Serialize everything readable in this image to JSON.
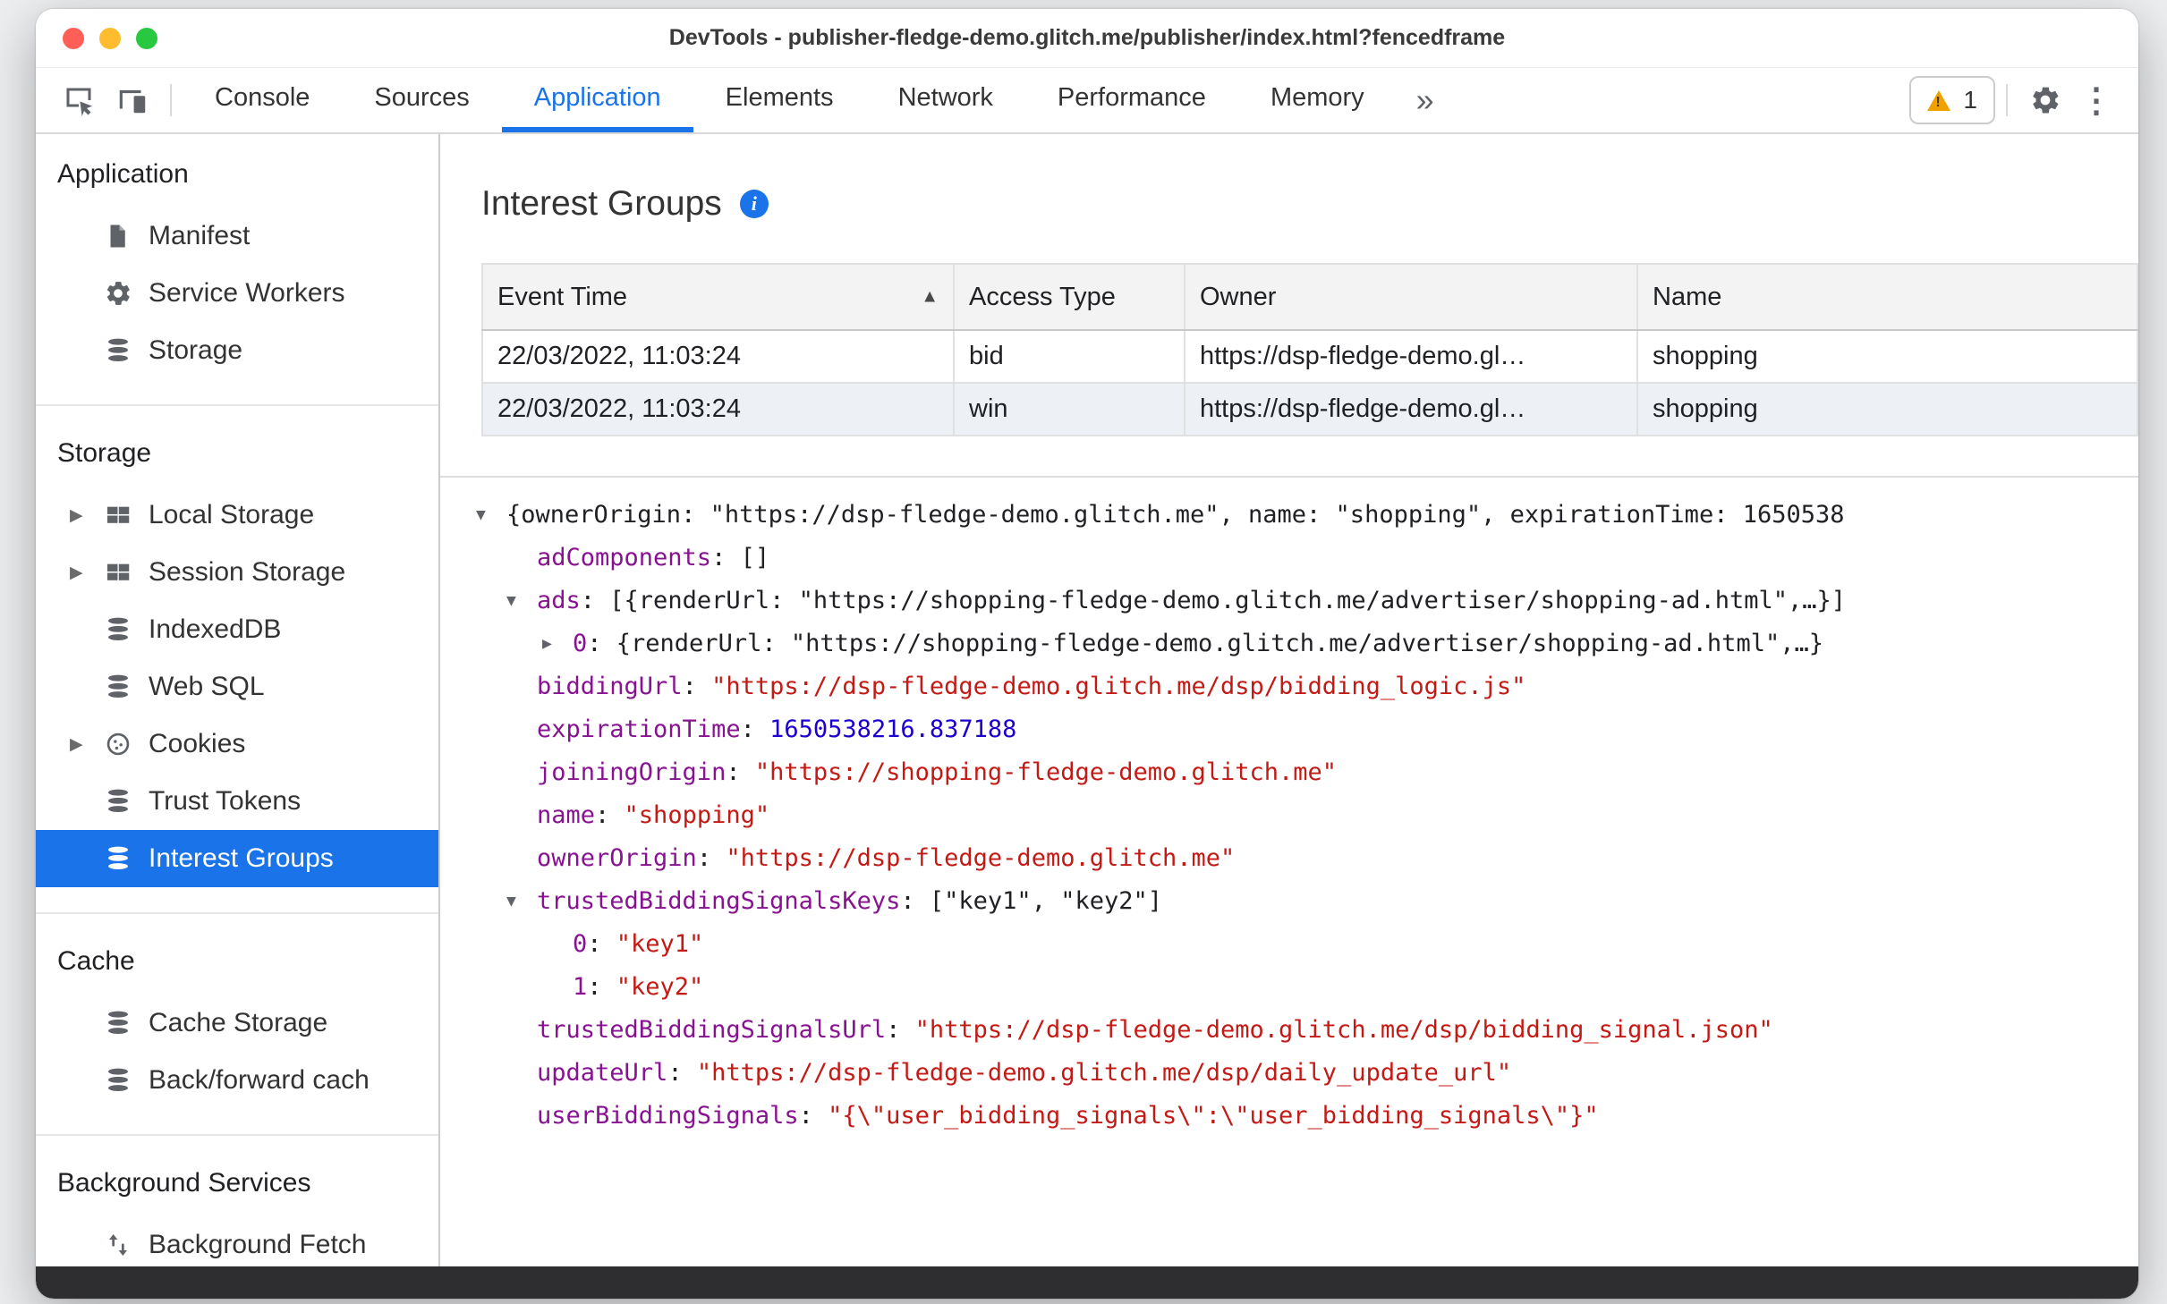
{
  "window": {
    "title": "DevTools - publisher-fledge-demo.glitch.me/publisher/index.html?fencedframe"
  },
  "toolbar": {
    "tabs": [
      "Console",
      "Sources",
      "Application",
      "Elements",
      "Network",
      "Performance",
      "Memory"
    ],
    "active_tab": "Application",
    "more_tabs_label": "»",
    "warning_count": "1"
  },
  "sidebar": {
    "sections": [
      {
        "header": "Application",
        "items": [
          {
            "label": "Manifest",
            "icon": "file"
          },
          {
            "label": "Service Workers",
            "icon": "gear"
          },
          {
            "label": "Storage",
            "icon": "database"
          }
        ]
      },
      {
        "header": "Storage",
        "items": [
          {
            "label": "Local Storage",
            "icon": "grid",
            "expandable": true
          },
          {
            "label": "Session Storage",
            "icon": "grid",
            "expandable": true
          },
          {
            "label": "IndexedDB",
            "icon": "database"
          },
          {
            "label": "Web SQL",
            "icon": "database"
          },
          {
            "label": "Cookies",
            "icon": "cookie",
            "expandable": true
          },
          {
            "label": "Trust Tokens",
            "icon": "database"
          },
          {
            "label": "Interest Groups",
            "icon": "database",
            "selected": true
          }
        ]
      },
      {
        "header": "Cache",
        "items": [
          {
            "label": "Cache Storage",
            "icon": "database"
          },
          {
            "label": "Back/forward cach",
            "icon": "database"
          }
        ]
      },
      {
        "header": "Background Services",
        "items": [
          {
            "label": "Background Fetch",
            "icon": "fetch"
          }
        ]
      }
    ]
  },
  "main": {
    "heading": "Interest Groups",
    "table": {
      "columns": [
        "Event Time",
        "Access Type",
        "Owner",
        "Name"
      ],
      "sort": {
        "column": "Event Time",
        "direction": "asc"
      },
      "rows": [
        {
          "event_time": "22/03/2022, 11:03:24",
          "access_type": "bid",
          "owner": "https://dsp-fledge-demo.gl…",
          "name": "shopping"
        },
        {
          "event_time": "22/03/2022, 11:03:24",
          "access_type": "win",
          "owner": "https://dsp-fledge-demo.gl…",
          "name": "shopping"
        }
      ]
    },
    "tree": {
      "lines": [
        {
          "indent": 0,
          "arrow": "down",
          "segments": [
            {
              "t": "{ownerOrigin: \"https://dsp-fledge-demo.glitch.me\", name: \"shopping\", expirationTime: 1650538",
              "c": "plain"
            }
          ]
        },
        {
          "indent": 1,
          "arrow": null,
          "segments": [
            {
              "t": "adComponents",
              "c": "key"
            },
            {
              "t": ": []",
              "c": "plain"
            }
          ]
        },
        {
          "indent": 1,
          "arrow": "down",
          "segments": [
            {
              "t": "ads",
              "c": "key"
            },
            {
              "t": ": [{renderUrl: \"https://shopping-fledge-demo.glitch.me/advertiser/shopping-ad.html\",…}]",
              "c": "plain"
            }
          ]
        },
        {
          "indent": 2,
          "arrow": "right",
          "segments": [
            {
              "t": "0",
              "c": "key"
            },
            {
              "t": ": {renderUrl: \"https://shopping-fledge-demo.glitch.me/advertiser/shopping-ad.html\",…}",
              "c": "plain"
            }
          ]
        },
        {
          "indent": 1,
          "arrow": null,
          "segments": [
            {
              "t": "biddingUrl",
              "c": "key"
            },
            {
              "t": ": ",
              "c": "plain"
            },
            {
              "t": "\"https://dsp-fledge-demo.glitch.me/dsp/bidding_logic.js\"",
              "c": "string"
            }
          ]
        },
        {
          "indent": 1,
          "arrow": null,
          "segments": [
            {
              "t": "expirationTime",
              "c": "key"
            },
            {
              "t": ": ",
              "c": "plain"
            },
            {
              "t": "1650538216.837188",
              "c": "number"
            }
          ]
        },
        {
          "indent": 1,
          "arrow": null,
          "segments": [
            {
              "t": "joiningOrigin",
              "c": "key"
            },
            {
              "t": ": ",
              "c": "plain"
            },
            {
              "t": "\"https://shopping-fledge-demo.glitch.me\"",
              "c": "string"
            }
          ]
        },
        {
          "indent": 1,
          "arrow": null,
          "segments": [
            {
              "t": "name",
              "c": "key"
            },
            {
              "t": ": ",
              "c": "plain"
            },
            {
              "t": "\"shopping\"",
              "c": "string"
            }
          ]
        },
        {
          "indent": 1,
          "arrow": null,
          "segments": [
            {
              "t": "ownerOrigin",
              "c": "key"
            },
            {
              "t": ": ",
              "c": "plain"
            },
            {
              "t": "\"https://dsp-fledge-demo.glitch.me\"",
              "c": "string"
            }
          ]
        },
        {
          "indent": 1,
          "arrow": "down",
          "segments": [
            {
              "t": "trustedBiddingSignalsKeys",
              "c": "key"
            },
            {
              "t": ": [\"key1\", \"key2\"]",
              "c": "plain"
            }
          ]
        },
        {
          "indent": 2,
          "arrow": null,
          "segments": [
            {
              "t": "0",
              "c": "key"
            },
            {
              "t": ": ",
              "c": "plain"
            },
            {
              "t": "\"key1\"",
              "c": "string"
            }
          ]
        },
        {
          "indent": 2,
          "arrow": null,
          "segments": [
            {
              "t": "1",
              "c": "key"
            },
            {
              "t": ": ",
              "c": "plain"
            },
            {
              "t": "\"key2\"",
              "c": "string"
            }
          ]
        },
        {
          "indent": 1,
          "arrow": null,
          "segments": [
            {
              "t": "trustedBiddingSignalsUrl",
              "c": "key"
            },
            {
              "t": ": ",
              "c": "plain"
            },
            {
              "t": "\"https://dsp-fledge-demo.glitch.me/dsp/bidding_signal.json\"",
              "c": "string"
            }
          ]
        },
        {
          "indent": 1,
          "arrow": null,
          "segments": [
            {
              "t": "updateUrl",
              "c": "key"
            },
            {
              "t": ": ",
              "c": "plain"
            },
            {
              "t": "\"https://dsp-fledge-demo.glitch.me/dsp/daily_update_url\"",
              "c": "string"
            }
          ]
        },
        {
          "indent": 1,
          "arrow": null,
          "segments": [
            {
              "t": "userBiddingSignals",
              "c": "key"
            },
            {
              "t": ": ",
              "c": "plain"
            },
            {
              "t": "\"{\\\"user_bidding_signals\\\":\\\"user_bidding_signals\\\"}\"",
              "c": "string"
            }
          ]
        }
      ]
    }
  },
  "colors": {
    "accent": "#1a73e8",
    "property": "#881391",
    "string": "#c41a16",
    "number": "#1c00cf",
    "warning": "#f0a100",
    "close": "#ff5f57",
    "minimize": "#febc2e",
    "maximize": "#28c840"
  }
}
